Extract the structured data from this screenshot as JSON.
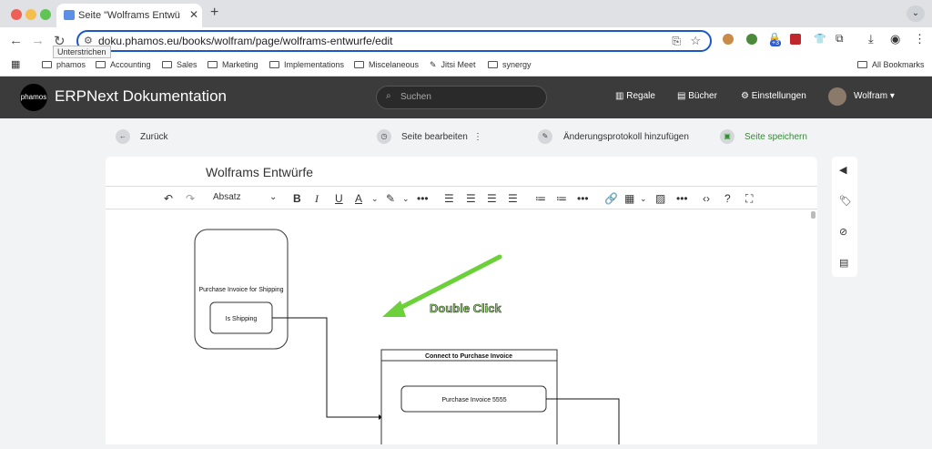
{
  "browser": {
    "tab_title": "Seite \"Wolframs Entwürfe\" be",
    "url": "doku.phamos.eu/books/wolfram/page/wolframs-entwurfe/edit",
    "tooltip": "Unterstrichen",
    "bookmarks": [
      "phamos",
      "Accounting",
      "Sales",
      "Marketing",
      "Implementations",
      "Miscelaneous",
      "Jitsi Meet",
      "synergy"
    ],
    "all_bookmarks": "All Bookmarks",
    "ext_badge": "+3"
  },
  "app": {
    "logo_text": "phamos",
    "title": "ERPNext Dokumentation",
    "search_placeholder": "Suchen",
    "nav": {
      "regale": "Regale",
      "buecher": "Bücher",
      "einstellungen": "Einstellungen",
      "user": "Wolfram"
    }
  },
  "actions": {
    "back": "Zurück",
    "edit_page": "Seite bearbeiten",
    "changelog": "Änderungsprotokoll hinzufügen",
    "save": "Seite speichern"
  },
  "editor": {
    "page_title": "Wolframs Entwürfe",
    "block_format": "Absatz"
  },
  "diagram": {
    "box1_title": "Purchase Invoice for Shipping",
    "box1_inner": "Is Shipping",
    "box2_title": "Connect to Purchase Invoice",
    "box2_inner": "Purchase Invoice 5555",
    "annotation": "Double Click",
    "annotation_color": "#6cd03a"
  },
  "colors": {
    "appbar": "#3b3b3b",
    "save": "#2f8f2f",
    "url_border": "#1a57c9"
  }
}
